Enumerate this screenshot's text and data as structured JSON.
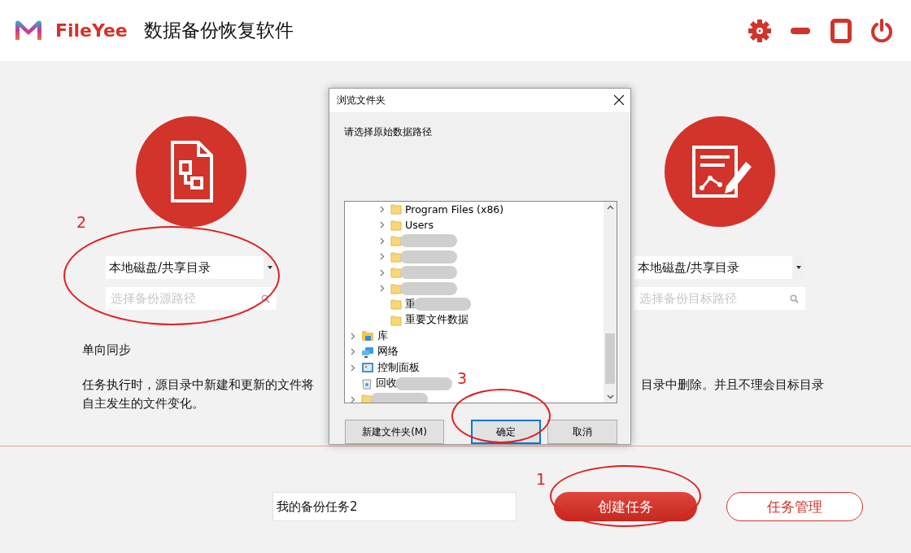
{
  "header": {
    "brand": "FileYee",
    "title": "数据备份恢复软件"
  },
  "source": {
    "select_value": "本地磁盘/共享目录",
    "path_placeholder": "选择备份源路径"
  },
  "target": {
    "select_value": "本地磁盘/共享目录",
    "path_placeholder": "选择备份目标路径"
  },
  "mode": {
    "title": "单向同步",
    "description_left": "任务执行时，源目录中新建和更新的文件将",
    "description_right": "目录中删除。并且不理会目标目录",
    "description_line2": "自主发生的文件变化。"
  },
  "bottom": {
    "task_name": "我的备份任务2",
    "buttons": [
      {
        "label": "创建任务",
        "kind": "primary"
      },
      {
        "label": "任务管理",
        "kind": "outline"
      }
    ]
  },
  "dialog": {
    "title": "浏览文件夹",
    "prompt": "请选择原始数据路径",
    "tree": [
      {
        "children": [
          {
            "label": "Program Files (x86)",
            "kind": "folder",
            "expandable": true,
            "blurred": false
          },
          {
            "label": "Users",
            "kind": "folder",
            "expandable": true,
            "blurred": false
          },
          {
            "kind": "folder",
            "expandable": true,
            "blurred": true
          },
          {
            "kind": "folder",
            "expandable": true,
            "blurred": true
          },
          {
            "kind": "folder",
            "expandable": true,
            "blurred": true
          },
          {
            "kind": "folder",
            "expandable": true,
            "blurred": true
          },
          {
            "label": "重",
            "kind": "folder",
            "expandable": false,
            "blurred": true
          },
          {
            "label": "重要文件数据",
            "kind": "folder",
            "expandable": false,
            "blurred": false
          }
        ]
      },
      {
        "label": "库",
        "kind": "library",
        "expandable": true,
        "blurred": false
      },
      {
        "label": "网络",
        "kind": "network",
        "expandable": true,
        "blurred": false
      },
      {
        "label": "控制面板",
        "kind": "control",
        "expandable": true,
        "blurred": false
      },
      {
        "label": "回收",
        "kind": "bin",
        "expandable": false,
        "blurred": true
      },
      {
        "kind": "folder",
        "expandable": true,
        "blurred": true
      }
    ],
    "buttons": [
      {
        "label": "新建文件夹(M)",
        "selected": false
      },
      {
        "label": "确定",
        "selected": true
      },
      {
        "label": "取消",
        "selected": false
      }
    ]
  },
  "annotations": [
    "2",
    "3",
    "1"
  ]
}
